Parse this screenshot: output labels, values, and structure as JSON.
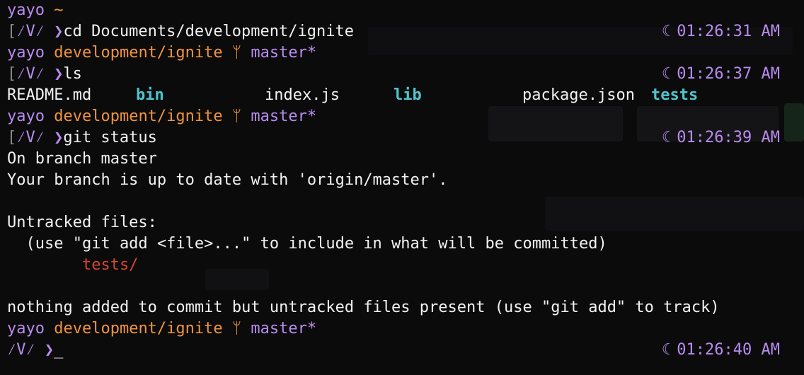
{
  "prompt": {
    "user": "yayo",
    "git_icon": "branch-icon",
    "symbol": "ᐱᐱ⁢ᐳ",
    "time_icon": "moon-icon"
  },
  "lines": {
    "l1_path": "~",
    "cmd1": "cd Documents/development/ignite",
    "time1": "01:26:31 AM",
    "l2_path": "development/ignite",
    "l2_branch": "master*",
    "cmd2": "ls",
    "time2": "01:26:37 AM",
    "ls_files": [
      "README.md",
      "bin",
      "index.js",
      "lib",
      "package.json",
      "tests"
    ],
    "l4_path": "development/ignite",
    "l4_branch": "master*",
    "cmd3": "git status",
    "time3": "01:26:39 AM",
    "status1": "On branch master",
    "status2": "Your branch is up to date with 'origin/master'.",
    "status3": "Untracked files:",
    "status4": "  (use \"git add <file>...\" to include in what will be committed)",
    "untracked": "tests/",
    "status5": "nothing added to commit but untracked files present (use \"git add\" to track)",
    "l6_path": "development/ignite",
    "l6_branch": "master*",
    "time4": "01:26:40 AM",
    "cursor": "_"
  }
}
